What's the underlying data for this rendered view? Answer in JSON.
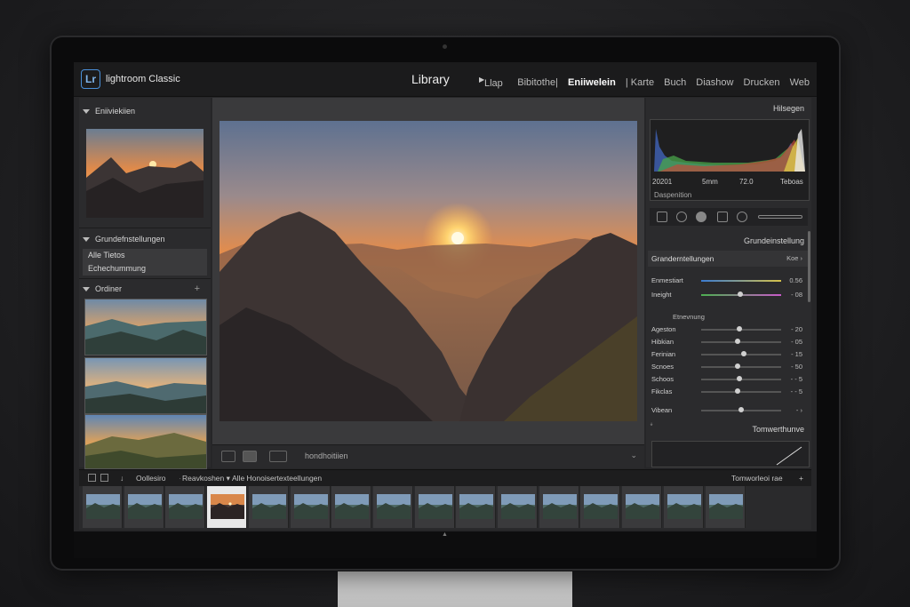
{
  "app": {
    "name": "lightroom Classic",
    "logo": "Lr"
  },
  "module": {
    "title": "Library",
    "sub": "Llap"
  },
  "modules": [
    "Bibitothe|",
    "Eniiwelein",
    "| Karte",
    "Buch",
    "Diashow",
    "Drucken",
    "Web"
  ],
  "active_module": "Eniiwelein",
  "left": {
    "navigator_label": "Eniiviekiien",
    "catalog_label": "Grundefnstellungen",
    "catalog_items": [
      "Alle Tietos",
      "Echechummung"
    ],
    "folders_label": "Ordiner",
    "plus": "+"
  },
  "right": {
    "histogram_label": "Hilsegen",
    "histo_labels": [
      "20201",
      "5mm",
      "72.0",
      "Teboas"
    ],
    "disposition": "Daspenition",
    "section1": "Grundeinstellung",
    "section2": "Granderntellungen",
    "section2_right": "Koe ›",
    "sliders_top": [
      {
        "label": "Enmestiart",
        "value": "0.56",
        "pos": 0.5,
        "color": "#4aa"
      },
      {
        "label": "Ineight",
        "value": "- 08",
        "pos": 0.45,
        "color": "#8a6"
      }
    ],
    "subsection": "Etnevnung",
    "sliders": [
      {
        "label": "Ageston",
        "value": "- 20",
        "pos": 0.48
      },
      {
        "label": "Hibkian",
        "value": "- 05",
        "pos": 0.45
      },
      {
        "label": "Ferinian",
        "value": "- 15",
        "pos": 0.53
      },
      {
        "label": "Scnoes",
        "value": "- 50",
        "pos": 0.46
      },
      {
        "label": "Schoos",
        "value": "- - 5",
        "pos": 0.48
      },
      {
        "label": "Fikclas",
        "value": "- - 5",
        "pos": 0.46
      }
    ],
    "vibrance": {
      "label": "Vibean",
      "value": "- ›",
      "pos": 0.48
    },
    "tone_curve": "Tomwerthunve"
  },
  "center": {
    "toolbar_label": "hondhoitiien"
  },
  "filmstrip": {
    "labels": [
      "Oollesiro",
      "Reavkoshen ▾",
      "Alle Honoisertexteellungen"
    ],
    "right_label": "Tomworleoi rae",
    "count": 16,
    "selected_index": 3
  }
}
